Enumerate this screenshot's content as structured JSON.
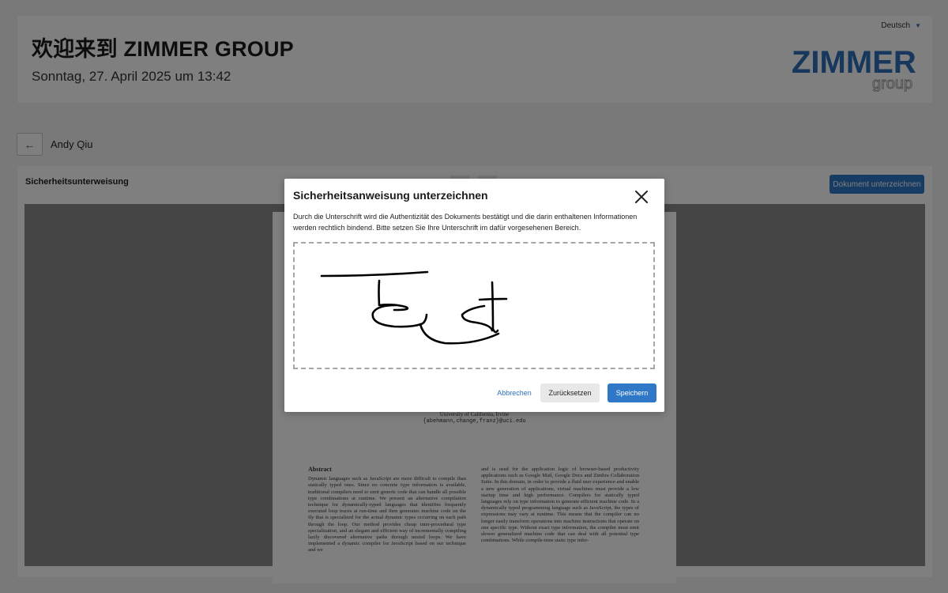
{
  "header": {
    "welcome": "欢迎来到 ZIMMER GROUP",
    "datetime": "Sonntag, 27. April 2025 um 13:42",
    "language": "Deutsch",
    "logo_text": "ZIMMER",
    "logo_subtext": "group",
    "brand_color": "#2f6fb8"
  },
  "nav": {
    "back_icon": "arrow-left-icon",
    "user_name": "Andy Qiu"
  },
  "document": {
    "title": "Sicherheitsunterweisung",
    "sign_button": "Dokument unterzeichnen",
    "paper": {
      "affiliation": "University of California, Irvine",
      "email": "{abehmann,change,franz}@uci.edu",
      "abstract_heading": "Abstract",
      "abstract_text": "Dynamic languages such as JavaScript are more difficult to compile than statically typed ones. Since no concrete type information is available, traditional compilers need to emit generic code that can handle all possible type combinations at runtime. We present an alternative compilation technique for dynamically-typed languages that identifies frequently executed loop traces at run-time and then generates machine code on the fly that is specialized for the actual dynamic types occurring on each path through the loop. Our method provides cheap inter-procedural type specialization, and an elegant and efficient way of incrementally compiling lazily discovered alternative paths through nested loops. We have implemented a dynamic compiler for JavaScript based on our technique and we",
      "right_text": "and is used for the application logic of browser-based productivity applications such as Google Mail, Google Docs and Zimbra Collaboration Suite. In this domain, in order to provide a fluid user experience and enable a new generation of applications, virtual machines must provide a low startup time and high performance. Compilers for statically typed languages rely on type information to generate efficient machine code. In a dynamically typed programming language such as JavaScript, the types of expressions may vary at runtime. This means that the compiler can no longer easily transform operations into machine instructions that operate on one specific type. Without exact type information, the compiler must emit slower generalized machine code that can deal with all potential type combinations. While compile-time static type infer-"
    }
  },
  "modal": {
    "title": "Sicherheitsanweisung unterzeichnen",
    "description": "Durch die Unterschrift wird die Authentizität des Dokuments bestätigt und die darin enthaltenen Informationen werden rechtlich bindend. Bitte setzen Sie Ihre Unterschrift im dafür vorgesehenen Bereich.",
    "close_icon": "close-icon",
    "signature_state": "signed",
    "cancel_label": "Abbrechen",
    "reset_label": "Zurücksetzen",
    "save_label": "Speichern",
    "accent_color": "#2f78c8"
  }
}
